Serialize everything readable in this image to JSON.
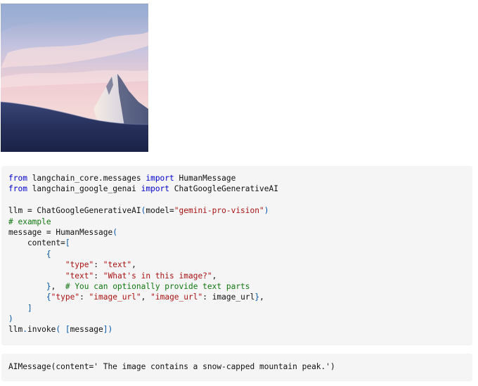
{
  "image": {
    "description_icon": "mountain-photo",
    "colors": {
      "sky_top": "#9fb4d6",
      "sky_pink": "#f2c5c9",
      "snow": "#2d3a6b",
      "peak_light": "#f4ece8",
      "peak_shadow": "#1f2a4f"
    }
  },
  "code": {
    "tokens": [
      [
        [
          "kw",
          "from"
        ],
        [
          "id",
          " langchain_core.messages "
        ],
        [
          "kw",
          "import"
        ],
        [
          "id",
          " HumanMessage"
        ]
      ],
      [
        [
          "kw",
          "from"
        ],
        [
          "id",
          " langchain_google_genai "
        ],
        [
          "kw",
          "import"
        ],
        [
          "id",
          " ChatGoogleGenerativeAI"
        ]
      ],
      [],
      [
        [
          "id",
          "llm = ChatGoogleGenerativeAI"
        ],
        [
          "pun",
          "("
        ],
        [
          "id",
          "model="
        ],
        [
          "str",
          "\"gemini-pro-vision\""
        ],
        [
          "pun",
          ")"
        ]
      ],
      [
        [
          "com",
          "# example"
        ]
      ],
      [
        [
          "id",
          "message = HumanMessage"
        ],
        [
          "pun",
          "("
        ]
      ],
      [
        [
          "id",
          "    content="
        ],
        [
          "pun",
          "["
        ]
      ],
      [
        [
          "pun",
          "        {"
        ]
      ],
      [
        [
          "id",
          "            "
        ],
        [
          "str",
          "\"type\""
        ],
        [
          "id",
          ": "
        ],
        [
          "str",
          "\"text\""
        ],
        [
          "id",
          ","
        ]
      ],
      [
        [
          "id",
          "            "
        ],
        [
          "str",
          "\"text\""
        ],
        [
          "id",
          ": "
        ],
        [
          "str",
          "\"What's in this image?\""
        ],
        [
          "id",
          ","
        ]
      ],
      [
        [
          "pun",
          "        }"
        ],
        [
          "id",
          ",  "
        ],
        [
          "com",
          "# You can optionally provide text parts"
        ]
      ],
      [
        [
          "id",
          "        "
        ],
        [
          "pun",
          "{"
        ],
        [
          "str",
          "\"type\""
        ],
        [
          "id",
          ": "
        ],
        [
          "str",
          "\"image_url\""
        ],
        [
          "id",
          ", "
        ],
        [
          "str",
          "\"image_url\""
        ],
        [
          "id",
          ": image_url"
        ],
        [
          "pun",
          "}"
        ],
        [
          "id",
          ","
        ]
      ],
      [
        [
          "pun",
          "    ]"
        ]
      ],
      [
        [
          "pun",
          ")"
        ]
      ],
      [
        [
          "id",
          "llm"
        ],
        [
          "pun",
          "."
        ],
        [
          "id",
          "invoke"
        ],
        [
          "pun",
          "( ["
        ],
        [
          "id",
          "message"
        ],
        [
          "pun",
          "])"
        ]
      ]
    ]
  },
  "output": {
    "text": "AIMessage(content=' The image contains a snow-capped mountain peak.')"
  }
}
